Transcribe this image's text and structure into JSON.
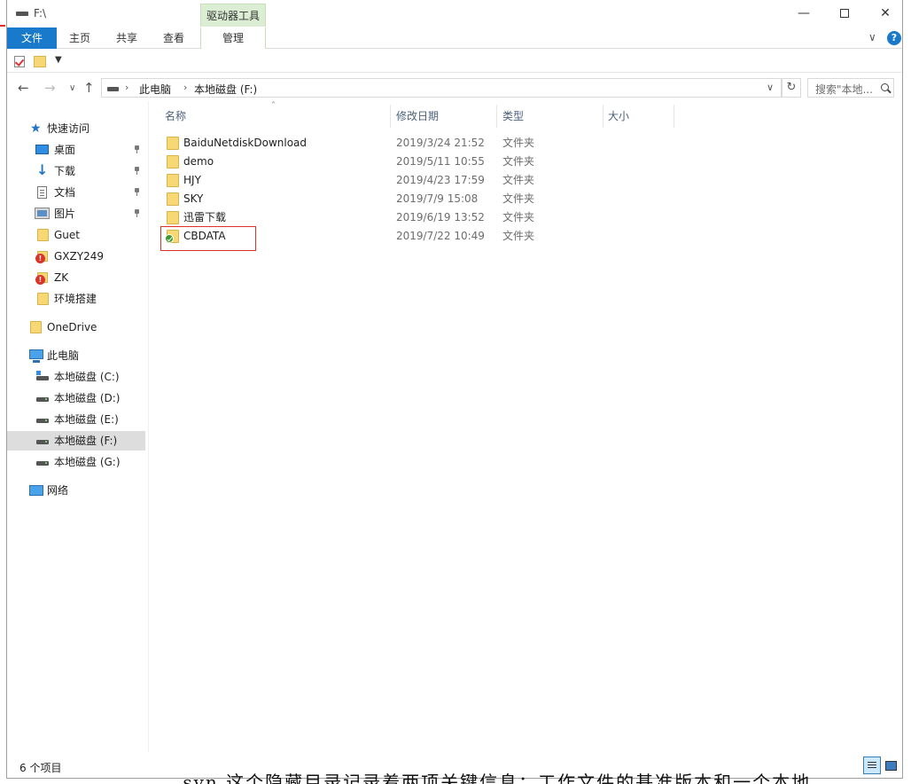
{
  "window": {
    "title": "F:\\",
    "drive_tools_label": "驱动器工具"
  },
  "ribbon": {
    "file_tab": "文件",
    "home_tab": "主页",
    "share_tab": "共享",
    "view_tab": "查看",
    "manage_tab": "管理"
  },
  "address": {
    "segments": [
      "此电脑",
      "本地磁盘 (F:)"
    ],
    "search_placeholder": "搜索\"本地..."
  },
  "nav_pane": {
    "quick_access": "快速访问",
    "quick_items": [
      {
        "label": "桌面",
        "icon": "desktop-icon",
        "pinned": true
      },
      {
        "label": "下载",
        "icon": "download-icon",
        "pinned": true
      },
      {
        "label": "文档",
        "icon": "document-icon",
        "pinned": true
      },
      {
        "label": "图片",
        "icon": "picture-icon",
        "pinned": true
      },
      {
        "label": "Guet",
        "icon": "folder-icon",
        "pinned": false
      },
      {
        "label": "GXZY249",
        "icon": "folder-error-icon",
        "pinned": false
      },
      {
        "label": "ZK",
        "icon": "folder-error-icon",
        "pinned": false
      },
      {
        "label": "环境搭建",
        "icon": "folder-icon",
        "pinned": false
      }
    ],
    "onedrive": "OneDrive",
    "this_pc": "此电脑",
    "drives": [
      {
        "label": "本地磁盘 (C:)"
      },
      {
        "label": "本地磁盘 (D:)"
      },
      {
        "label": "本地磁盘 (E:)"
      },
      {
        "label": "本地磁盘 (F:)",
        "selected": true
      },
      {
        "label": "本地磁盘 (G:)"
      }
    ],
    "network": "网络"
  },
  "columns": {
    "name": "名称",
    "date": "修改日期",
    "type": "类型",
    "size": "大小"
  },
  "files": [
    {
      "name": "BaiduNetdiskDownload",
      "date": "2019/3/24 21:52",
      "type": "文件夹"
    },
    {
      "name": "demo",
      "date": "2019/5/11 10:55",
      "type": "文件夹"
    },
    {
      "name": "HJY",
      "date": "2019/4/23 17:59",
      "type": "文件夹"
    },
    {
      "name": "SKY",
      "date": "2019/7/9 15:08",
      "type": "文件夹"
    },
    {
      "name": "迅雷下载",
      "date": "2019/6/19 13:52",
      "type": "文件夹"
    },
    {
      "name": "CBDATA",
      "date": "2019/7/22 10:49",
      "type": "文件夹",
      "sync_status": "synced"
    }
  ],
  "status": {
    "item_count": "6 个项目"
  },
  "behind_text": ".svn 这个隐藏目录记录着两项关键信息：工作文件的基准版本和一个本地"
}
